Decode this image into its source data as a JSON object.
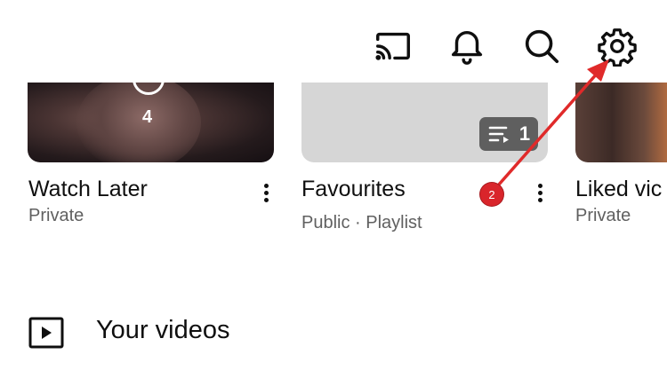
{
  "topbar": {
    "icons": [
      "cast-icon",
      "notification-bell-icon",
      "search-icon",
      "settings-gear-icon"
    ]
  },
  "playlists": [
    {
      "title": "Watch Later",
      "subtitle": "Private",
      "thumb_count": "4"
    },
    {
      "title": "Favourites",
      "subtitle": "Public · Playlist",
      "badge_count": "1"
    },
    {
      "title": "Liked vic",
      "subtitle": "Private"
    }
  ],
  "your_videos": {
    "label": "Your videos"
  },
  "annotation": {
    "step_number": "2",
    "color": "#e02a2a"
  }
}
